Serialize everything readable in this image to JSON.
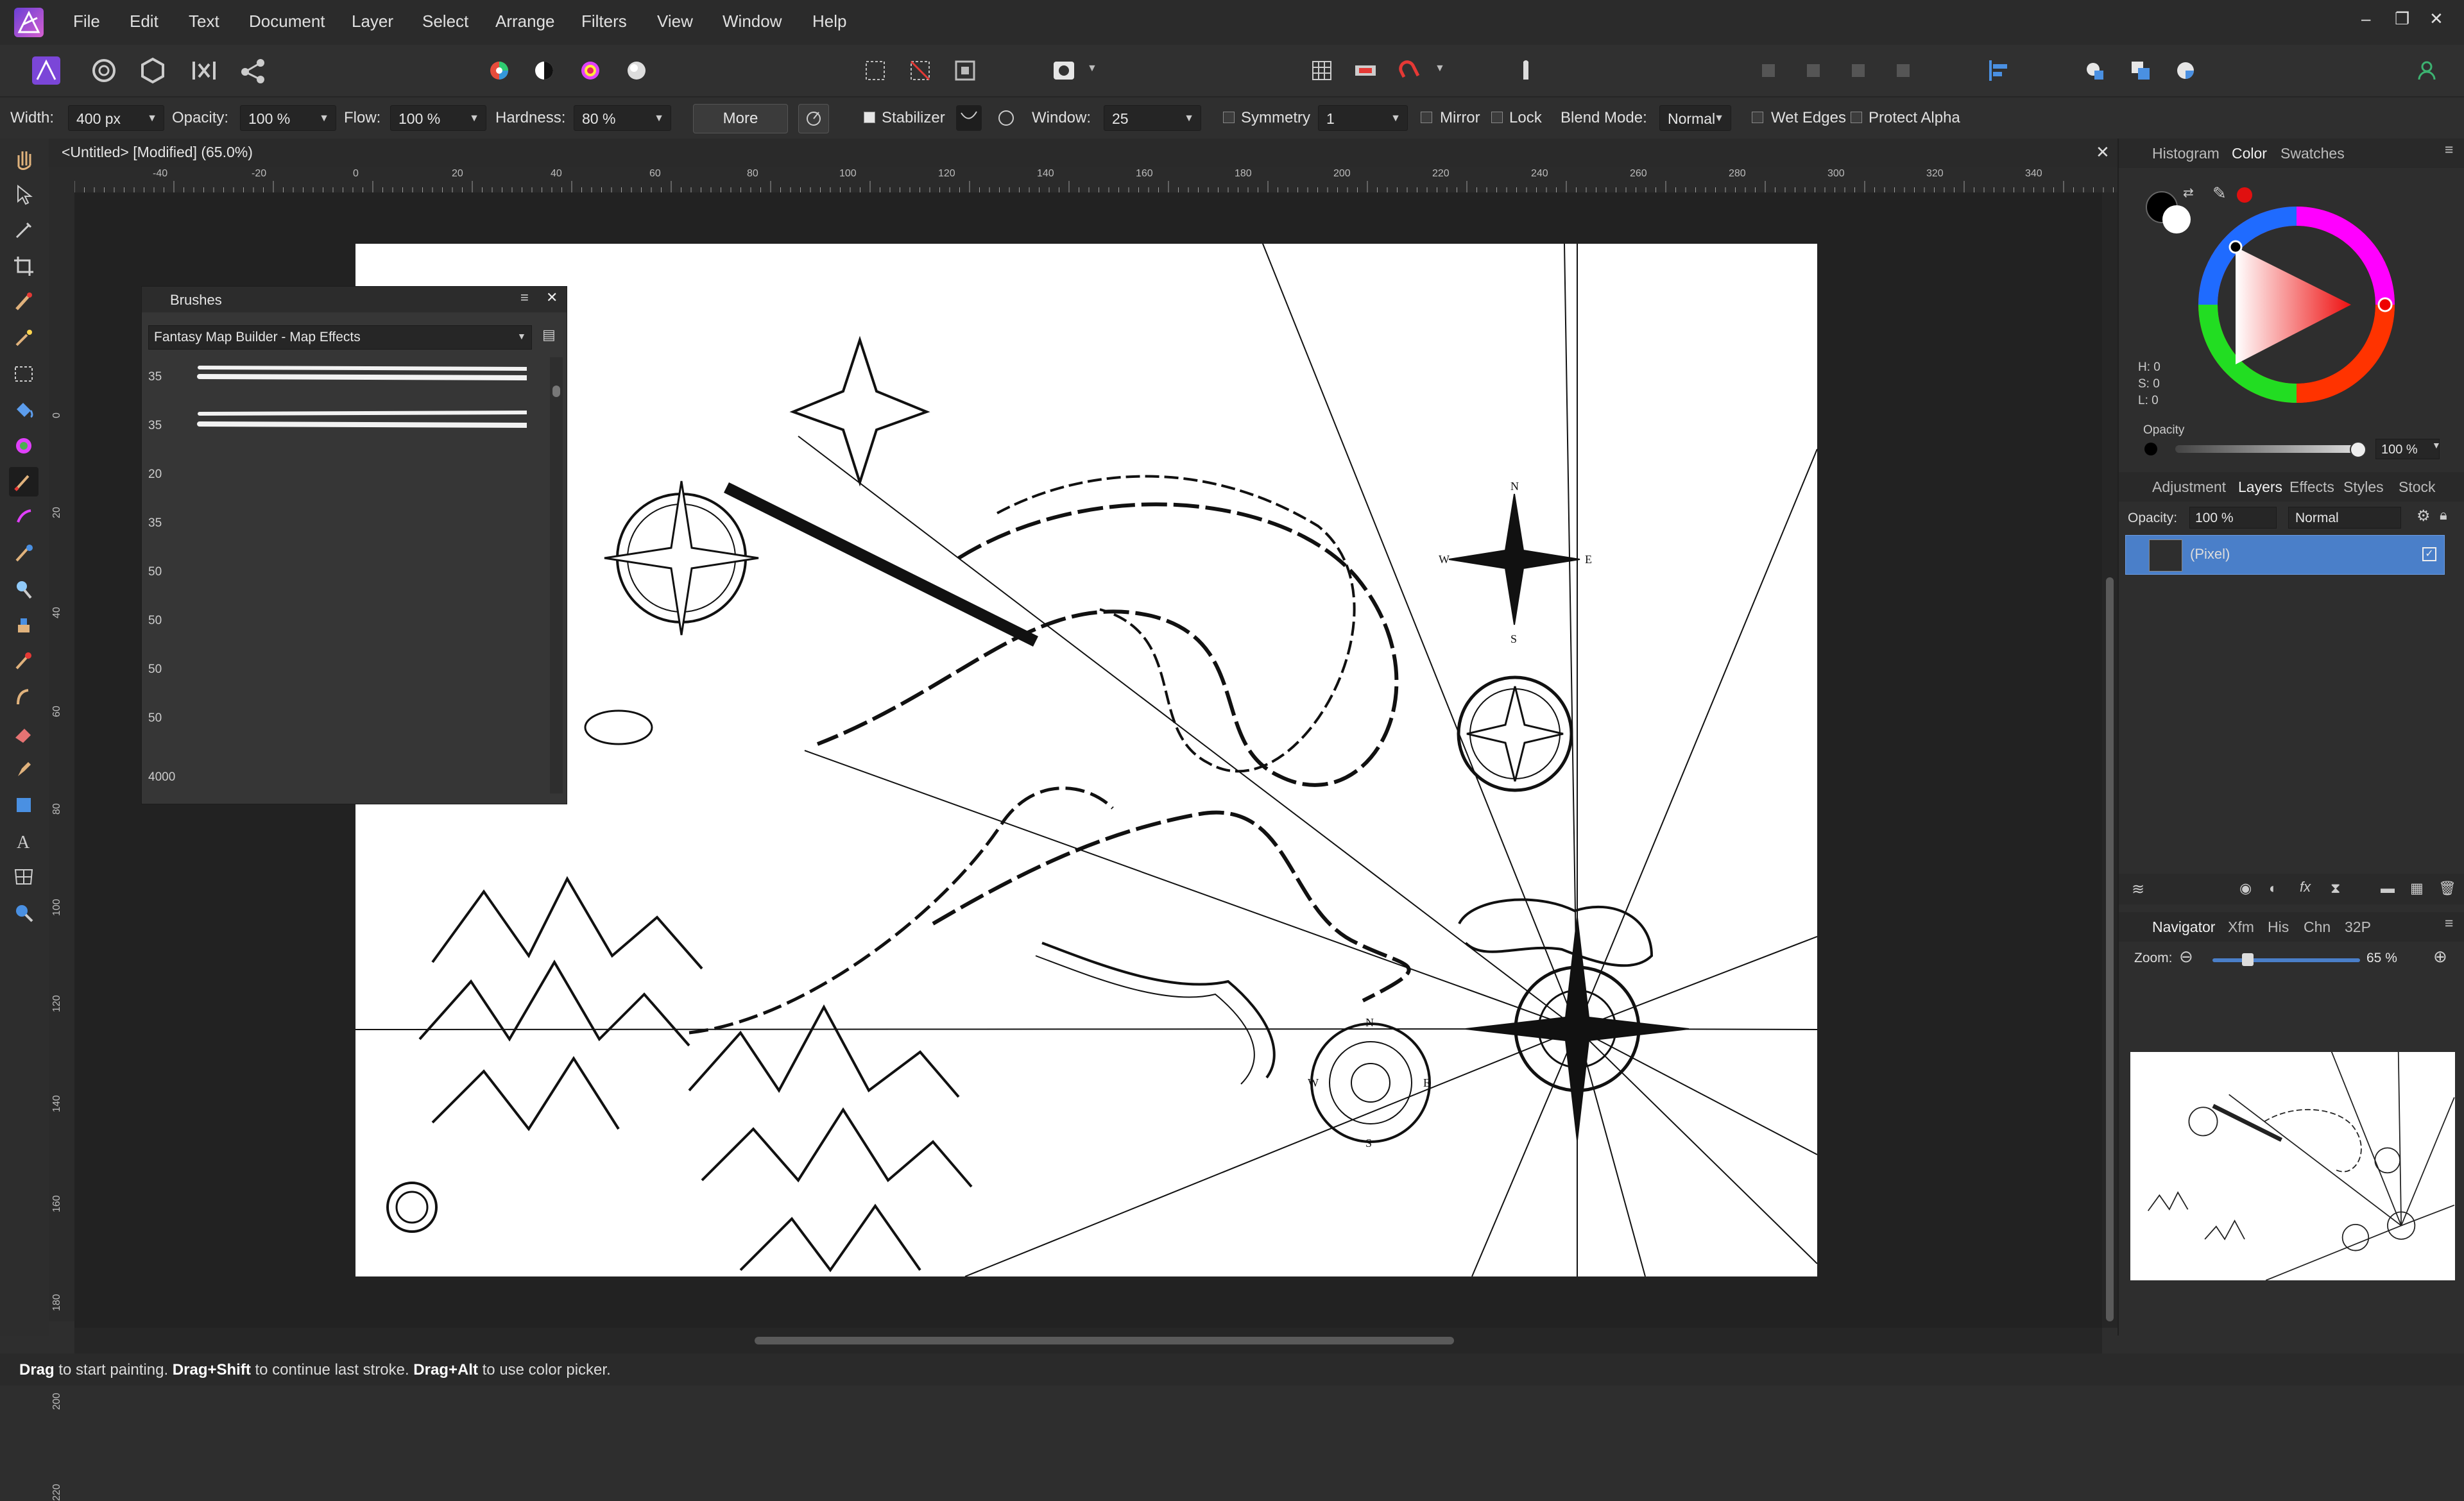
{
  "menubar": {
    "items": [
      "File",
      "Edit",
      "Text",
      "Document",
      "Layer",
      "Select",
      "Arrange",
      "Filters",
      "View",
      "Window",
      "Help"
    ],
    "window_controls": [
      "–",
      "❐",
      "✕"
    ]
  },
  "context_toolbar": {
    "width_label": "Width:",
    "width_value": "400 px",
    "opacity_label": "Opacity:",
    "opacity_value": "100 %",
    "flow_label": "Flow:",
    "flow_value": "100 %",
    "hardness_label": "Hardness:",
    "hardness_value": "80 %",
    "more_label": "More",
    "stabilizer_label": "Stabilizer",
    "window_label": "Window:",
    "window_value": "25",
    "symmetry_label": "Symmetry",
    "symmetry_value": "1",
    "mirror_label": "Mirror",
    "lock_label": "Lock",
    "blend_label": "Blend Mode:",
    "blend_value": "Normal",
    "wet_edges_label": "Wet Edges",
    "protect_alpha_label": "Protect Alpha"
  },
  "document": {
    "tab_title": "<Untitled> [Modified] (65.0%)",
    "ruler_unit": "mm",
    "ruler_top_labels": [
      "-40",
      "-20",
      "0",
      "20",
      "40",
      "60",
      "80",
      "100",
      "120",
      "140",
      "160",
      "180",
      "200",
      "220",
      "240",
      "260",
      "280",
      "300",
      "320",
      "340"
    ],
    "ruler_left_labels": [
      "0",
      "20",
      "40",
      "60",
      "80",
      "100",
      "120",
      "140",
      "160",
      "180",
      "200",
      "220"
    ]
  },
  "brushes_panel": {
    "title": "Brushes",
    "category": "Fantasy Map Builder - Map Effects",
    "brush_sizes": [
      "35",
      "35",
      "20",
      "35",
      "50",
      "50",
      "50",
      "50",
      "4000"
    ]
  },
  "color_panel": {
    "tabs": [
      "Histogram",
      "Color",
      "Swatches"
    ],
    "active_tab": "Color",
    "h_label": "H: 0",
    "s_label": "S: 0",
    "l_label": "L: 0",
    "opacity_label": "Opacity",
    "opacity_value": "100 %"
  },
  "layers_panel": {
    "tabs": [
      "Adjustment",
      "Layers",
      "Effects",
      "Styles",
      "Stock"
    ],
    "active_tab": "Layers",
    "opacity_label": "Opacity:",
    "opacity_value": "100 %",
    "blend_value": "Normal",
    "layers": [
      {
        "name": "(Pixel)",
        "selected": true
      }
    ]
  },
  "navigator_panel": {
    "tabs": [
      "Navigator",
      "Xfm",
      "His",
      "Chn",
      "32P"
    ],
    "active_tab": "Navigator",
    "zoom_label": "Zoom:",
    "zoom_value": "65 %"
  },
  "statusbar": {
    "k1": "Drag",
    "t1": " to start painting. ",
    "k2": "Drag+Shift",
    "t2": " to continue last stroke. ",
    "k3": "Drag+Alt",
    "t3": " to use color picker."
  },
  "colors": {
    "accent": "#5c8fd6",
    "brand": "#8e44d9",
    "selection_blue": "#4a7fc9"
  }
}
